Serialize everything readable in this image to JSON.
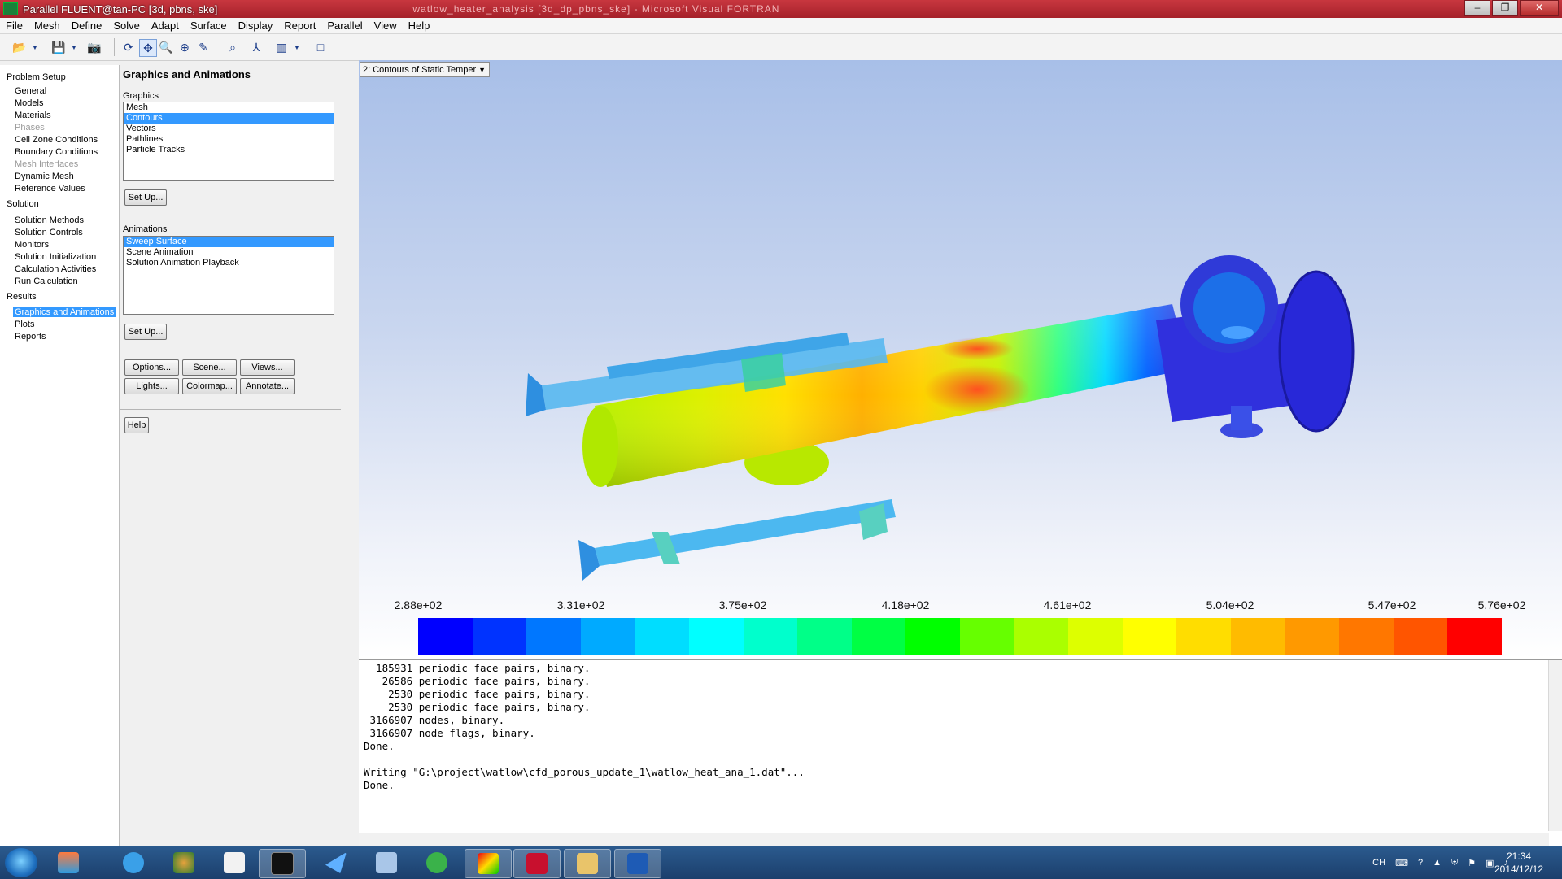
{
  "window": {
    "title": "Parallel FLUENT@tan-PC  [3d, pbns, ske]",
    "blurred_title": "watlow_heater_analysis [3d_dp_pbns_ske] - Microsoft Visual FORTRAN",
    "controls": [
      "–",
      "❐",
      "✕"
    ]
  },
  "menu": [
    "File",
    "Mesh",
    "Define",
    "Solve",
    "Adapt",
    "Surface",
    "Display",
    "Report",
    "Parallel",
    "View",
    "Help"
  ],
  "toolbar": {
    "icons": [
      "open-icon",
      "save-icon",
      "camera-icon",
      "rotate-icon",
      "pan-icon",
      "zoom-icon",
      "zoom-in-icon",
      "probe-icon",
      "fit-icon",
      "axes-icon",
      "layout-icon",
      "window-icon"
    ]
  },
  "nav": {
    "problem_setup": "Problem Setup",
    "problem_items": [
      "General",
      "Models",
      "Materials",
      "Phases",
      "Cell Zone Conditions",
      "Boundary Conditions",
      "Mesh Interfaces",
      "Dynamic Mesh",
      "Reference Values"
    ],
    "solution": "Solution",
    "solution_items": [
      "Solution Methods",
      "Solution Controls",
      "Monitors",
      "Solution Initialization",
      "Calculation Activities",
      "Run Calculation"
    ],
    "results": "Results",
    "results_items": [
      "Graphics and Animations",
      "Plots",
      "Reports"
    ]
  },
  "task": {
    "heading": "Graphics and Animations",
    "graphics_label": "Graphics",
    "graphics_items": [
      "Mesh",
      "Contours",
      "Vectors",
      "Pathlines",
      "Particle Tracks"
    ],
    "setup_label": "Set Up...",
    "animations_label": "Animations",
    "animation_items": [
      "Sweep Surface",
      "Scene Animation",
      "Solution Animation Playback"
    ],
    "options": "Options...",
    "scene": "Scene...",
    "views": "Views...",
    "lights": "Lights...",
    "colormap": "Colormap...",
    "annotate": "Annotate...",
    "help": "Help"
  },
  "graphics": {
    "window_select": "2: Contours of Static Temper",
    "colorbar_ticks": [
      "2.88e+02",
      "3.31e+02",
      "3.75e+02",
      "4.18e+02",
      "4.61e+02",
      "5.04e+02",
      "5.47e+02",
      "5.76e+02"
    ],
    "colormap": [
      "#0000ff",
      "#0033ff",
      "#0077ff",
      "#00aaff",
      "#00ddff",
      "#00ffff",
      "#00ffcc",
      "#00ff88",
      "#00ff44",
      "#00ff00",
      "#66ff00",
      "#aaff00",
      "#ddff00",
      "#ffff00",
      "#ffdd00",
      "#ffbb00",
      "#ff9900",
      "#ff7700",
      "#ff5500",
      "#ff0000"
    ]
  },
  "console": {
    "lines": [
      "  185931 periodic face pairs, binary.",
      "   26586 periodic face pairs, binary.",
      "    2530 periodic face pairs, binary.",
      "    2530 periodic face pairs, binary.",
      " 3166907 nodes, binary.",
      " 3166907 node flags, binary.",
      "Done.",
      "",
      "Writing \"G:\\project\\watlow\\cfd_porous_update_1\\watlow_heat_ana_1.dat\"...",
      "Done."
    ]
  },
  "taskbar": {
    "lang": "CH",
    "time": "21:34",
    "date": "2014/12/12"
  }
}
